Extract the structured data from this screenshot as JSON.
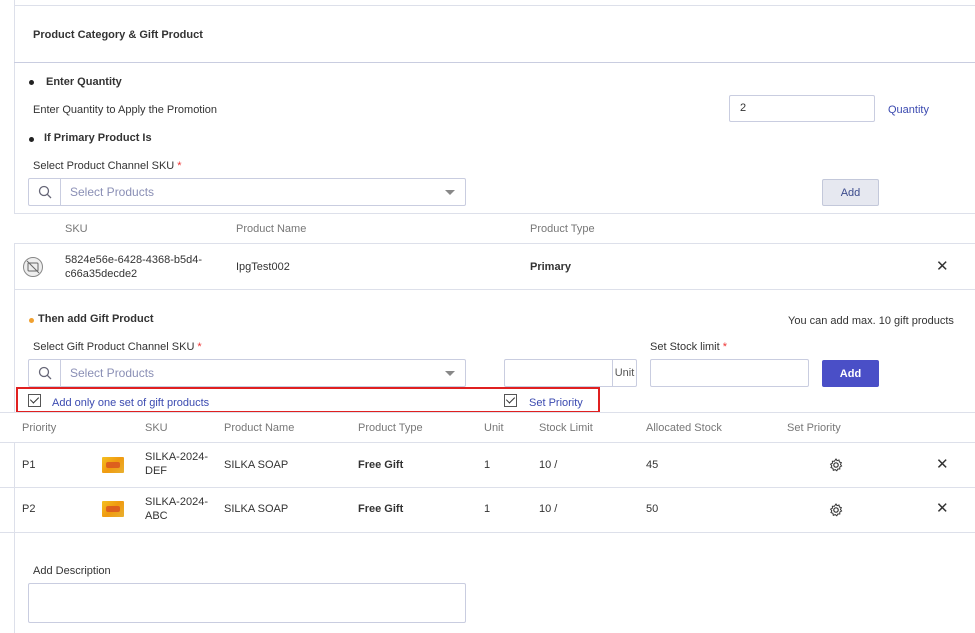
{
  "section_title": "Product Category & Gift Product",
  "quantity": {
    "heading": "Enter Quantity",
    "label": "Enter Quantity to Apply the Promotion",
    "value": "2",
    "unit_link": "Quantity"
  },
  "primary": {
    "heading": "If Primary Product Is",
    "select_label": "Select Product Channel SKU",
    "required_mark": "*",
    "placeholder": "Select Products",
    "add_label": "Add",
    "columns": [
      "SKU",
      "Product Name",
      "Product Type"
    ],
    "rows": [
      {
        "sku_line1": "5824e56e-6428-4368-b5d4-",
        "sku_line2": "c66a35decde2",
        "name": "IpgTest002",
        "type": "Primary"
      }
    ]
  },
  "gift": {
    "heading": "Then add Gift Product",
    "max_note": "You can add max. 10 gift products",
    "select_label": "Select Gift Product Channel SKU",
    "required_mark": "*",
    "placeholder": "Select Products",
    "unit_label": "Unit",
    "stock_label": "Set Stock limit",
    "add_label": "Add",
    "only_one_set_label": "Add only one set of gift products",
    "set_priority_label": "Set Priority",
    "columns": [
      "Priority",
      "SKU",
      "Product Name",
      "Product Type",
      "Unit",
      "Stock Limit",
      "Allocated Stock",
      "Set Priority"
    ],
    "rows": [
      {
        "priority": "P1",
        "sku_line1": "SILKA-2024-",
        "sku_line2": "DEF",
        "name": "SILKA SOAP",
        "type": "Free Gift",
        "unit": "1",
        "stock_limit": "10 /",
        "allocated": "45"
      },
      {
        "priority": "P2",
        "sku_line1": "SILKA-2024-",
        "sku_line2": "ABC",
        "name": "SILKA SOAP",
        "type": "Free Gift",
        "unit": "1",
        "stock_limit": "10 /",
        "allocated": "50"
      }
    ]
  },
  "description": {
    "label": "Add Description"
  },
  "close_glyph": "✕"
}
